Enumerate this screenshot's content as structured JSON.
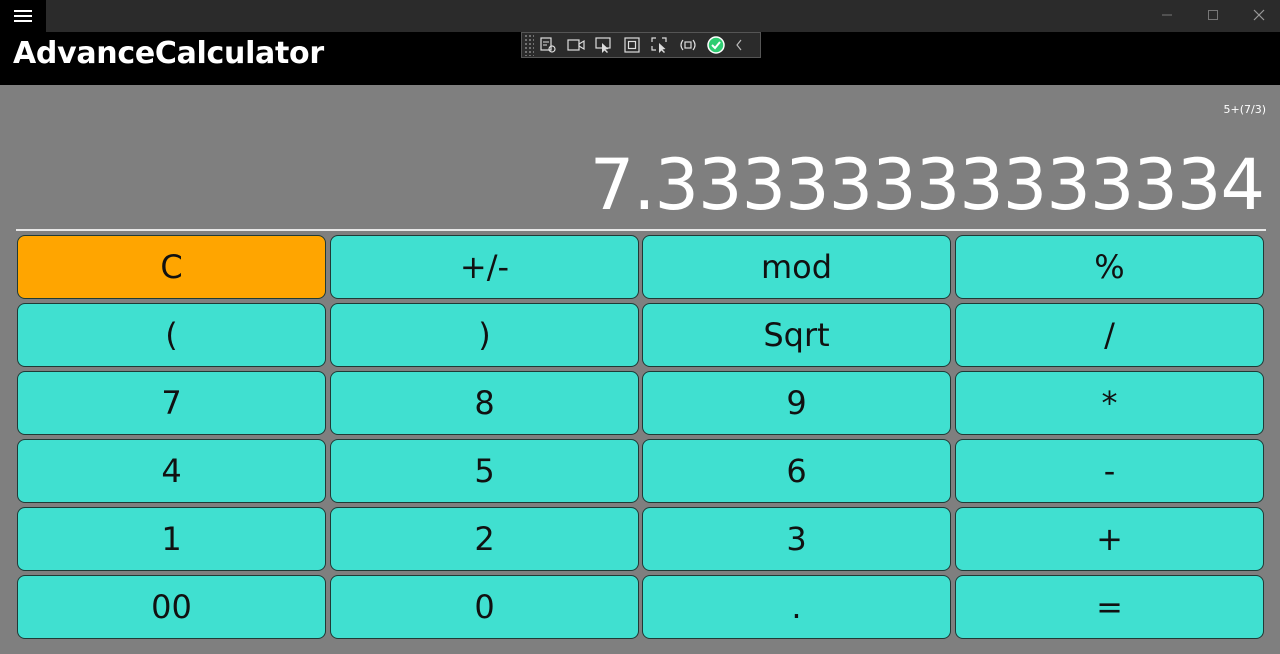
{
  "app": {
    "title": "AdvanceCalculator"
  },
  "display": {
    "expression": "5+(7/3)",
    "result": "7.33333333333334"
  },
  "keypad": [
    [
      "C",
      "+/-",
      "mod",
      "%"
    ],
    [
      "(",
      ")",
      "Sqrt",
      "/"
    ],
    [
      "7",
      "8",
      "9",
      "*"
    ],
    [
      "4",
      "5",
      "6",
      "-"
    ],
    [
      "1",
      "2",
      "3",
      "+"
    ],
    [
      "00",
      "0",
      ".",
      "="
    ]
  ],
  "colors": {
    "key": "#40e0d0",
    "clear_key": "#ffa500",
    "background": "#7f7f7f",
    "header": "#000000"
  },
  "devbar_tools": [
    "live-visual-tree-icon",
    "record-icon",
    "select-element-icon",
    "display-layout-adorners-icon",
    "track-focus-icon",
    "binding-failures-icon",
    "hot-reload-ok-icon",
    "collapse-toolbar-icon"
  ]
}
